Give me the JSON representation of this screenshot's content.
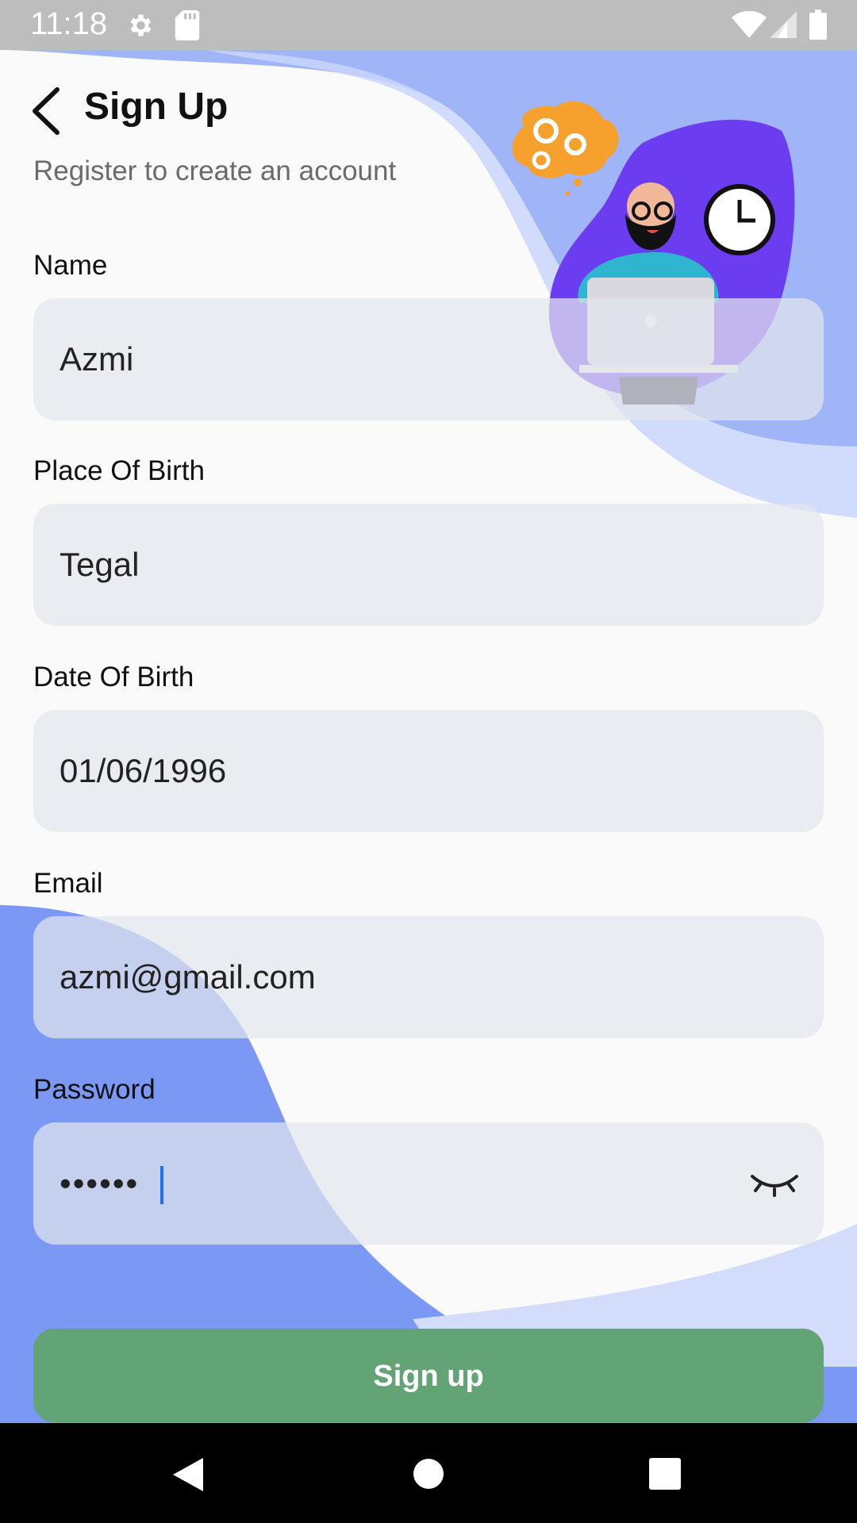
{
  "status_bar": {
    "time": "11:18",
    "icons": [
      "settings-icon",
      "sd-card-icon",
      "wifi-icon",
      "signal-icon",
      "battery-icon"
    ]
  },
  "header": {
    "title": "Sign Up",
    "subtitle": "Register to create an account",
    "back_icon": "chevron-left-icon"
  },
  "form": {
    "name": {
      "label": "Name",
      "value": "Azmi"
    },
    "place_of_birth": {
      "label": "Place Of Birth",
      "value": "Tegal"
    },
    "date_of_birth": {
      "label": "Date Of Birth",
      "value": "01/06/1996"
    },
    "email": {
      "label": "Email",
      "value": "azmi@gmail.com"
    },
    "password": {
      "label": "Password",
      "value": "••••••",
      "toggle_icon": "eye-closed-icon"
    }
  },
  "actions": {
    "signup_label": "Sign up"
  },
  "nav_bar": {
    "icons": [
      "nav-back-icon",
      "nav-home-icon",
      "nav-recents-icon"
    ]
  },
  "colors": {
    "accent_blue": "#6f8ff5",
    "button_green": "#63a477",
    "field_bg": "#e8ebef",
    "status_bar": "#bdbdbd"
  }
}
